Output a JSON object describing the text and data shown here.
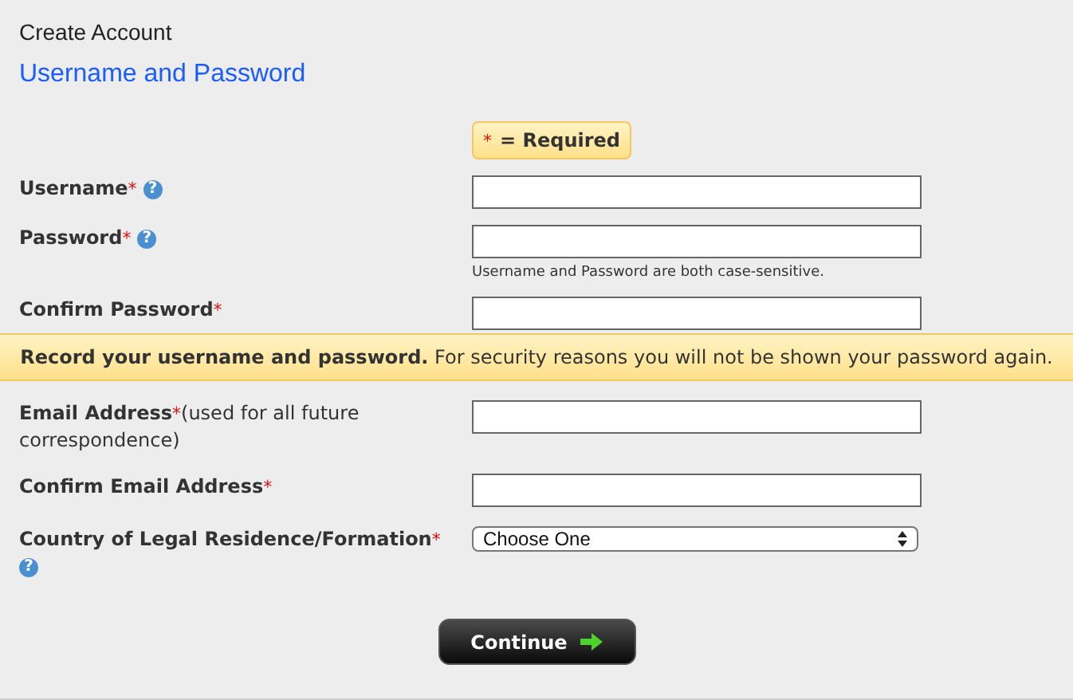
{
  "page": {
    "title": "Create Account",
    "section": "Username and Password"
  },
  "legend": {
    "mark": "*",
    "text": "= Required"
  },
  "fields_top": [
    {
      "kind": "text",
      "label": "Username",
      "mark": "*",
      "help": "?"
    },
    {
      "kind": "text",
      "label": "Password",
      "mark": "*",
      "help": "?",
      "note": "Username and Password are both case-sensitive."
    },
    {
      "kind": "text",
      "label": "Confirm Password",
      "mark": "*"
    }
  ],
  "banner": "**Record your username and password.** For security reasons you will not be shown your password again.",
  "fields_bottom": [
    {
      "kind": "text",
      "label": "Email Address",
      "mark": "*",
      "hint": "(used for all future correspondence)"
    },
    {
      "kind": "text",
      "label": "Confirm Email Address",
      "mark": "*"
    },
    {
      "kind": "select",
      "label": "Country of Legal Residence/Formation",
      "mark": "*",
      "help": "?",
      "value": "Choose One"
    }
  ],
  "button": {
    "label": "Continue"
  }
}
